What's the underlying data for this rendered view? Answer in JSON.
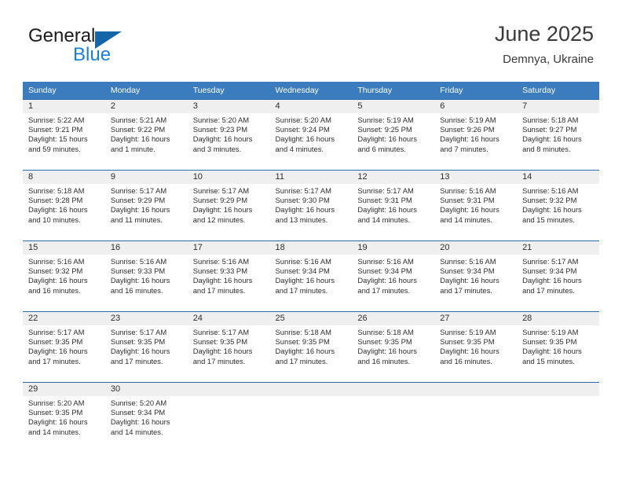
{
  "brand": {
    "name_top": "General",
    "name_bottom": "Blue",
    "accent_color": "#1c7fd6",
    "triangle_color": "#1565a8"
  },
  "header": {
    "title": "June 2025",
    "subtitle": "Demnya, Ukraine"
  },
  "theme": {
    "header_row_bg": "#3a7cbe",
    "row_border": "#2b6ca8",
    "day_band_bg": "#efeff0",
    "text": "#2d2d2d"
  },
  "calendar": {
    "weekday_headers": [
      "Sunday",
      "Monday",
      "Tuesday",
      "Wednesday",
      "Thursday",
      "Friday",
      "Saturday"
    ],
    "weeks": [
      [
        {
          "day": "1",
          "sunrise": "Sunrise: 5:22 AM",
          "sunset": "Sunset: 9:21 PM",
          "daylight": "Daylight: 15 hours and 59 minutes."
        },
        {
          "day": "2",
          "sunrise": "Sunrise: 5:21 AM",
          "sunset": "Sunset: 9:22 PM",
          "daylight": "Daylight: 16 hours and 1 minute."
        },
        {
          "day": "3",
          "sunrise": "Sunrise: 5:20 AM",
          "sunset": "Sunset: 9:23 PM",
          "daylight": "Daylight: 16 hours and 3 minutes."
        },
        {
          "day": "4",
          "sunrise": "Sunrise: 5:20 AM",
          "sunset": "Sunset: 9:24 PM",
          "daylight": "Daylight: 16 hours and 4 minutes."
        },
        {
          "day": "5",
          "sunrise": "Sunrise: 5:19 AM",
          "sunset": "Sunset: 9:25 PM",
          "daylight": "Daylight: 16 hours and 6 minutes."
        },
        {
          "day": "6",
          "sunrise": "Sunrise: 5:19 AM",
          "sunset": "Sunset: 9:26 PM",
          "daylight": "Daylight: 16 hours and 7 minutes."
        },
        {
          "day": "7",
          "sunrise": "Sunrise: 5:18 AM",
          "sunset": "Sunset: 9:27 PM",
          "daylight": "Daylight: 16 hours and 8 minutes."
        }
      ],
      [
        {
          "day": "8",
          "sunrise": "Sunrise: 5:18 AM",
          "sunset": "Sunset: 9:28 PM",
          "daylight": "Daylight: 16 hours and 10 minutes."
        },
        {
          "day": "9",
          "sunrise": "Sunrise: 5:17 AM",
          "sunset": "Sunset: 9:29 PM",
          "daylight": "Daylight: 16 hours and 11 minutes."
        },
        {
          "day": "10",
          "sunrise": "Sunrise: 5:17 AM",
          "sunset": "Sunset: 9:29 PM",
          "daylight": "Daylight: 16 hours and 12 minutes."
        },
        {
          "day": "11",
          "sunrise": "Sunrise: 5:17 AM",
          "sunset": "Sunset: 9:30 PM",
          "daylight": "Daylight: 16 hours and 13 minutes."
        },
        {
          "day": "12",
          "sunrise": "Sunrise: 5:17 AM",
          "sunset": "Sunset: 9:31 PM",
          "daylight": "Daylight: 16 hours and 14 minutes."
        },
        {
          "day": "13",
          "sunrise": "Sunrise: 5:16 AM",
          "sunset": "Sunset: 9:31 PM",
          "daylight": "Daylight: 16 hours and 14 minutes."
        },
        {
          "day": "14",
          "sunrise": "Sunrise: 5:16 AM",
          "sunset": "Sunset: 9:32 PM",
          "daylight": "Daylight: 16 hours and 15 minutes."
        }
      ],
      [
        {
          "day": "15",
          "sunrise": "Sunrise: 5:16 AM",
          "sunset": "Sunset: 9:32 PM",
          "daylight": "Daylight: 16 hours and 16 minutes."
        },
        {
          "day": "16",
          "sunrise": "Sunrise: 5:16 AM",
          "sunset": "Sunset: 9:33 PM",
          "daylight": "Daylight: 16 hours and 16 minutes."
        },
        {
          "day": "17",
          "sunrise": "Sunrise: 5:16 AM",
          "sunset": "Sunset: 9:33 PM",
          "daylight": "Daylight: 16 hours and 17 minutes."
        },
        {
          "day": "18",
          "sunrise": "Sunrise: 5:16 AM",
          "sunset": "Sunset: 9:34 PM",
          "daylight": "Daylight: 16 hours and 17 minutes."
        },
        {
          "day": "19",
          "sunrise": "Sunrise: 5:16 AM",
          "sunset": "Sunset: 9:34 PM",
          "daylight": "Daylight: 16 hours and 17 minutes."
        },
        {
          "day": "20",
          "sunrise": "Sunrise: 5:16 AM",
          "sunset": "Sunset: 9:34 PM",
          "daylight": "Daylight: 16 hours and 17 minutes."
        },
        {
          "day": "21",
          "sunrise": "Sunrise: 5:17 AM",
          "sunset": "Sunset: 9:34 PM",
          "daylight": "Daylight: 16 hours and 17 minutes."
        }
      ],
      [
        {
          "day": "22",
          "sunrise": "Sunrise: 5:17 AM",
          "sunset": "Sunset: 9:35 PM",
          "daylight": "Daylight: 16 hours and 17 minutes."
        },
        {
          "day": "23",
          "sunrise": "Sunrise: 5:17 AM",
          "sunset": "Sunset: 9:35 PM",
          "daylight": "Daylight: 16 hours and 17 minutes."
        },
        {
          "day": "24",
          "sunrise": "Sunrise: 5:17 AM",
          "sunset": "Sunset: 9:35 PM",
          "daylight": "Daylight: 16 hours and 17 minutes."
        },
        {
          "day": "25",
          "sunrise": "Sunrise: 5:18 AM",
          "sunset": "Sunset: 9:35 PM",
          "daylight": "Daylight: 16 hours and 17 minutes."
        },
        {
          "day": "26",
          "sunrise": "Sunrise: 5:18 AM",
          "sunset": "Sunset: 9:35 PM",
          "daylight": "Daylight: 16 hours and 16 minutes."
        },
        {
          "day": "27",
          "sunrise": "Sunrise: 5:19 AM",
          "sunset": "Sunset: 9:35 PM",
          "daylight": "Daylight: 16 hours and 16 minutes."
        },
        {
          "day": "28",
          "sunrise": "Sunrise: 5:19 AM",
          "sunset": "Sunset: 9:35 PM",
          "daylight": "Daylight: 16 hours and 15 minutes."
        }
      ],
      [
        {
          "day": "29",
          "sunrise": "Sunrise: 5:20 AM",
          "sunset": "Sunset: 9:35 PM",
          "daylight": "Daylight: 16 hours and 14 minutes."
        },
        {
          "day": "30",
          "sunrise": "Sunrise: 5:20 AM",
          "sunset": "Sunset: 9:34 PM",
          "daylight": "Daylight: 16 hours and 14 minutes."
        },
        {
          "day": "",
          "sunrise": "",
          "sunset": "",
          "daylight": ""
        },
        {
          "day": "",
          "sunrise": "",
          "sunset": "",
          "daylight": ""
        },
        {
          "day": "",
          "sunrise": "",
          "sunset": "",
          "daylight": ""
        },
        {
          "day": "",
          "sunrise": "",
          "sunset": "",
          "daylight": ""
        },
        {
          "day": "",
          "sunrise": "",
          "sunset": "",
          "daylight": ""
        }
      ]
    ]
  }
}
